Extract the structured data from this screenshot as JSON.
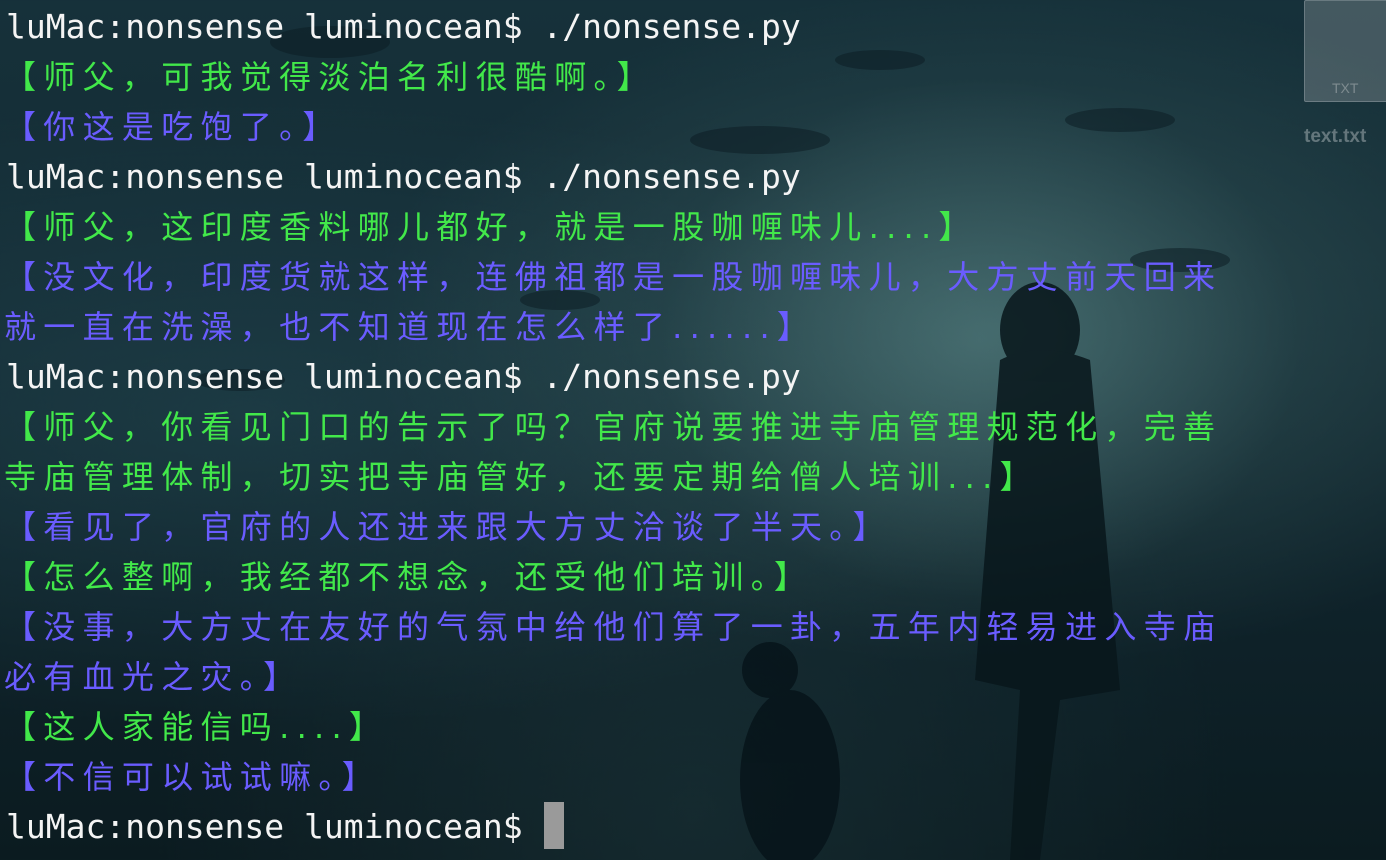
{
  "desktop": {
    "file_type": "TXT",
    "file_name": "text.txt"
  },
  "terminal": {
    "prompt": "luMac:nonsense luminocean$",
    "lines": [
      {
        "type": "prompt",
        "command": " ./nonsense.py"
      },
      {
        "type": "green",
        "text": "【师父，可我觉得淡泊名利很酷啊。】"
      },
      {
        "type": "purple",
        "text": "【你这是吃饱了。】"
      },
      {
        "type": "prompt",
        "command": " ./nonsense.py"
      },
      {
        "type": "green",
        "text": "【师父，这印度香料哪儿都好，就是一股咖喱味儿....】"
      },
      {
        "type": "purple",
        "text": "【没文化，印度货就这样，连佛祖都是一股咖喱味儿，大方丈前天回来"
      },
      {
        "type": "purple",
        "text": "就一直在洗澡，也不知道现在怎么样了......】"
      },
      {
        "type": "prompt",
        "command": " ./nonsense.py"
      },
      {
        "type": "green",
        "text": "【师父，你看见门口的告示了吗？官府说要推进寺庙管理规范化，完善"
      },
      {
        "type": "green",
        "text": "寺庙管理体制，切实把寺庙管好，还要定期给僧人培训...】"
      },
      {
        "type": "purple",
        "text": "【看见了，官府的人还进来跟大方丈洽谈了半天。】"
      },
      {
        "type": "green",
        "text": "【怎么整啊，我经都不想念，还受他们培训。】"
      },
      {
        "type": "purple",
        "text": "【没事，大方丈在友好的气氛中给他们算了一卦，五年内轻易进入寺庙"
      },
      {
        "type": "purple",
        "text": "必有血光之灾。】"
      },
      {
        "type": "green",
        "text": "【这人家能信吗....】"
      },
      {
        "type": "purple",
        "text": "【不信可以试试嘛。】"
      },
      {
        "type": "prompt",
        "command": " "
      }
    ]
  },
  "colors": {
    "green": "#42e84a",
    "purple": "#6a5cff",
    "prompt": "#f4f4f4"
  }
}
